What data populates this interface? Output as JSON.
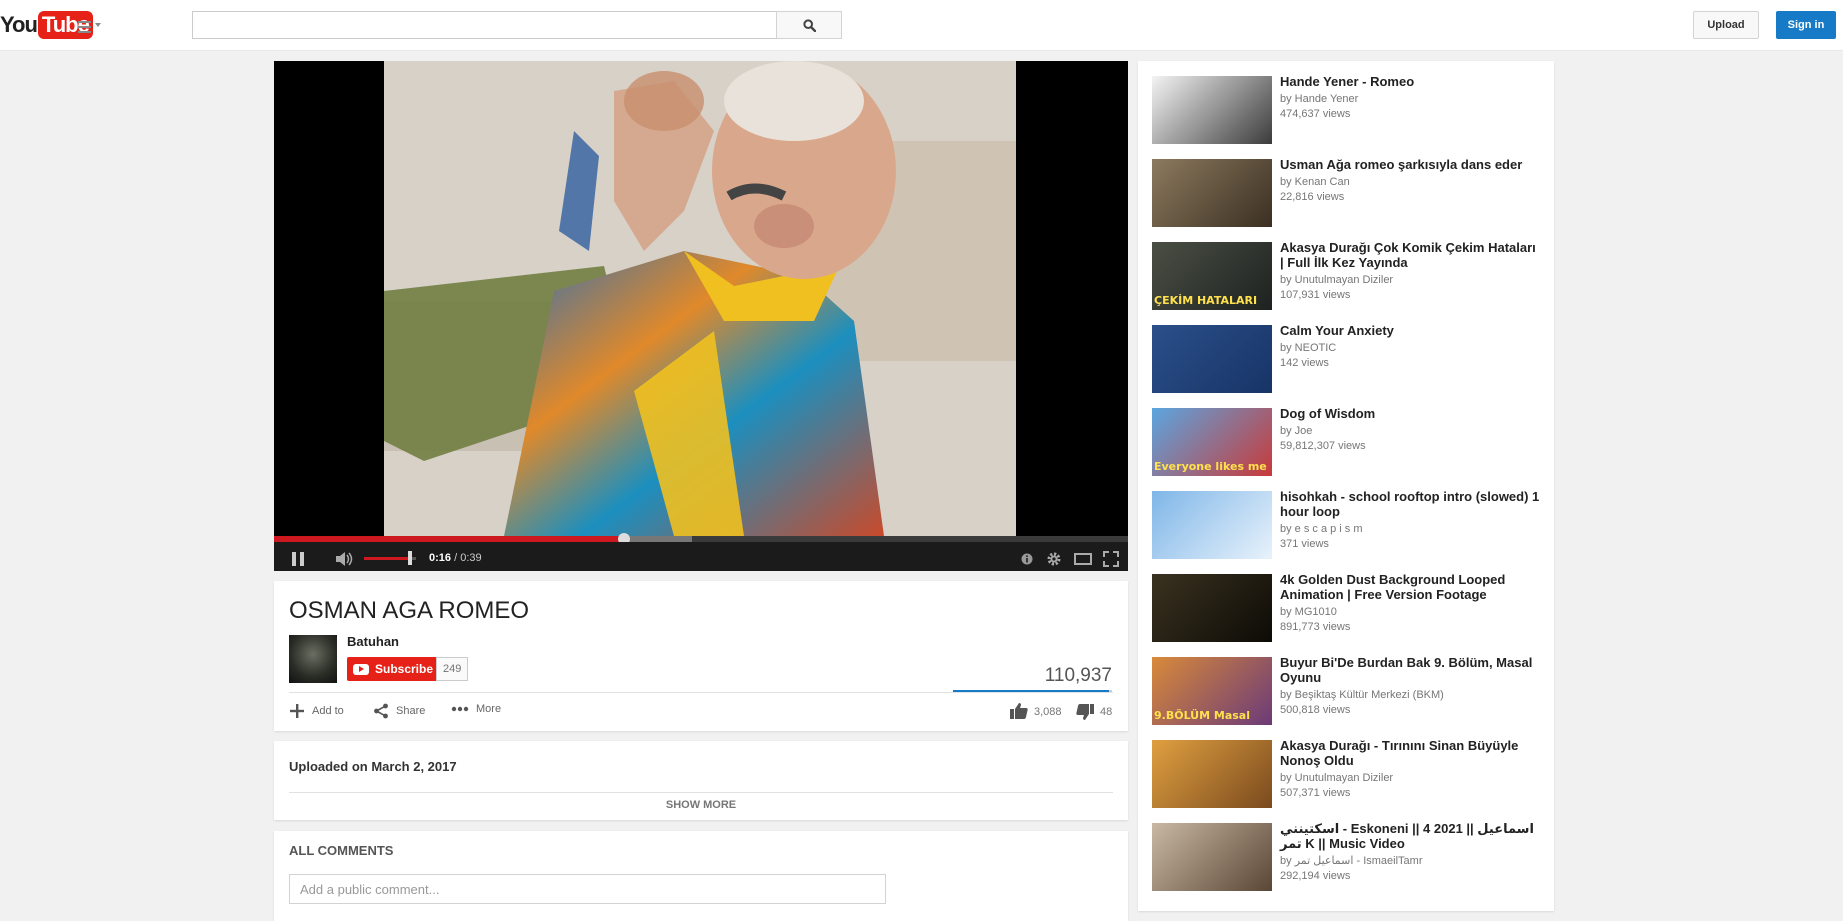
{
  "header": {
    "logo_left": "You",
    "logo_right": "Tube",
    "search_placeholder": "",
    "upload_label": "Upload",
    "signin_label": "Sign in"
  },
  "player": {
    "current_time": "0:16",
    "duration": "/ 0:39",
    "played_fraction": 0.41,
    "loaded_fraction": 0.49,
    "volume_fraction": 0.85
  },
  "video": {
    "title": "OSMAN AGA ROMEO",
    "channel": "Batuhan",
    "subscribe_label": "Subscribe",
    "subscriber_count": "249",
    "views": "110,937",
    "likes": "3,088",
    "dislikes": "48",
    "like_fraction": 0.98,
    "actions": {
      "add_to": "Add to",
      "share": "Share",
      "more": "More"
    }
  },
  "description": {
    "upload_date": "Uploaded on March 2, 2017",
    "show_more": "SHOW MORE"
  },
  "comments": {
    "header": "ALL COMMENTS",
    "placeholder": "Add a public comment..."
  },
  "recommendations": [
    {
      "title": "Hande Yener - Romeo",
      "channel": "by Hande Yener",
      "views": "474,637 views",
      "thumb_colors": [
        "#f4f4f4",
        "#3b3b3b"
      ]
    },
    {
      "title": "Usman Ağa romeo şarkısıyla dans eder",
      "channel": "by Kenan Can",
      "views": "22,816 views",
      "thumb_colors": [
        "#8c7a5e",
        "#3a2f22"
      ]
    },
    {
      "title": "Akasya Durağı Çok Komik Çekim Hataları | Full İlk Kez Yayında",
      "channel": "by Unutulmayan Diziler",
      "views": "107,931 views",
      "thumb_colors": [
        "#4a4f45",
        "#1e2220"
      ],
      "thumb_caption": "ÇEKİM HATALARI"
    },
    {
      "title": "Calm Your Anxiety",
      "channel": "by NEOTIC",
      "views": "142 views",
      "thumb_colors": [
        "#2b4f8a",
        "#173466"
      ]
    },
    {
      "title": "Dog of Wisdom",
      "channel": "by Joe",
      "views": "59,812,307 views",
      "thumb_colors": [
        "#5ba6e0",
        "#c83a3a"
      ],
      "thumb_caption": "Everyone likes me"
    },
    {
      "title": "hisohkah - school rooftop intro (slowed) 1 hour loop",
      "channel": "by e s c a p i s m",
      "views": "371 views",
      "thumb_colors": [
        "#7fb6e8",
        "#e8f2fb"
      ]
    },
    {
      "title": "4k Golden Dust Background Looped Animation | Free Version Footage",
      "channel": "by MG1010",
      "views": "891,773 views",
      "thumb_colors": [
        "#3a3220",
        "#0d0b06"
      ]
    },
    {
      "title": "Buyur Bi'De Burdan Bak 9. Bölüm, Masal Oyunu",
      "channel": "by Beşiktaş Kültür Merkezi (BKM)",
      "views": "500,818 views",
      "thumb_colors": [
        "#d98a3a",
        "#6b3a78"
      ],
      "thumb_caption": "9.BÖLÜM Masal"
    },
    {
      "title": "Akasya Durağı - Tırınını Sinan Büyüyle Nonoş Oldu",
      "channel": "by Unutulmayan Diziler",
      "views": "507,371 views",
      "thumb_colors": [
        "#e0a040",
        "#7a4a1e"
      ]
    },
    {
      "title": "اسكتينني - Eskoneni || 4 2021 || اسماعيل تمر K || Music Video",
      "channel": "by اسماعيل تمر - IsmaeilTamr",
      "views": "292,194 views",
      "thumb_colors": [
        "#c9b9a3",
        "#5a4636"
      ]
    }
  ]
}
